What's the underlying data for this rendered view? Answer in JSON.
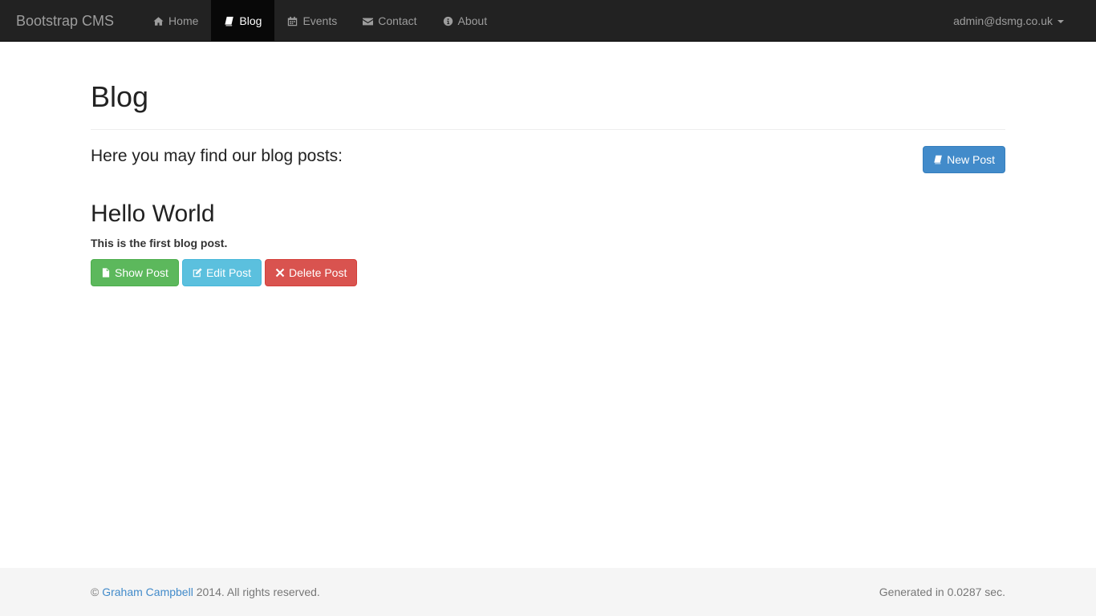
{
  "navbar": {
    "brand": "Bootstrap CMS",
    "items": [
      {
        "label": "Home",
        "icon": "home-icon",
        "active": false
      },
      {
        "label": "Blog",
        "icon": "book-icon",
        "active": true
      },
      {
        "label": "Events",
        "icon": "calendar-icon",
        "active": false
      },
      {
        "label": "Contact",
        "icon": "envelope-icon",
        "active": false
      },
      {
        "label": "About",
        "icon": "info-icon",
        "active": false
      }
    ],
    "user": "admin@dsmg.co.uk"
  },
  "page": {
    "title": "Blog",
    "intro": "Here you may find our blog posts:",
    "new_post_label": "New Post"
  },
  "post": {
    "title": "Hello World",
    "summary": "This is the first blog post.",
    "show_label": "Show Post",
    "edit_label": "Edit Post",
    "delete_label": "Delete Post"
  },
  "footer": {
    "copyright_symbol": "©",
    "author_link": "Graham Campbell",
    "copyright_rest": "2014. All rights reserved.",
    "generated": "Generated in 0.0287 sec."
  },
  "colors": {
    "navbar_bg": "#222222",
    "primary": "#428bca",
    "success": "#5cb85c",
    "info": "#5bc0de",
    "danger": "#d9534f"
  }
}
